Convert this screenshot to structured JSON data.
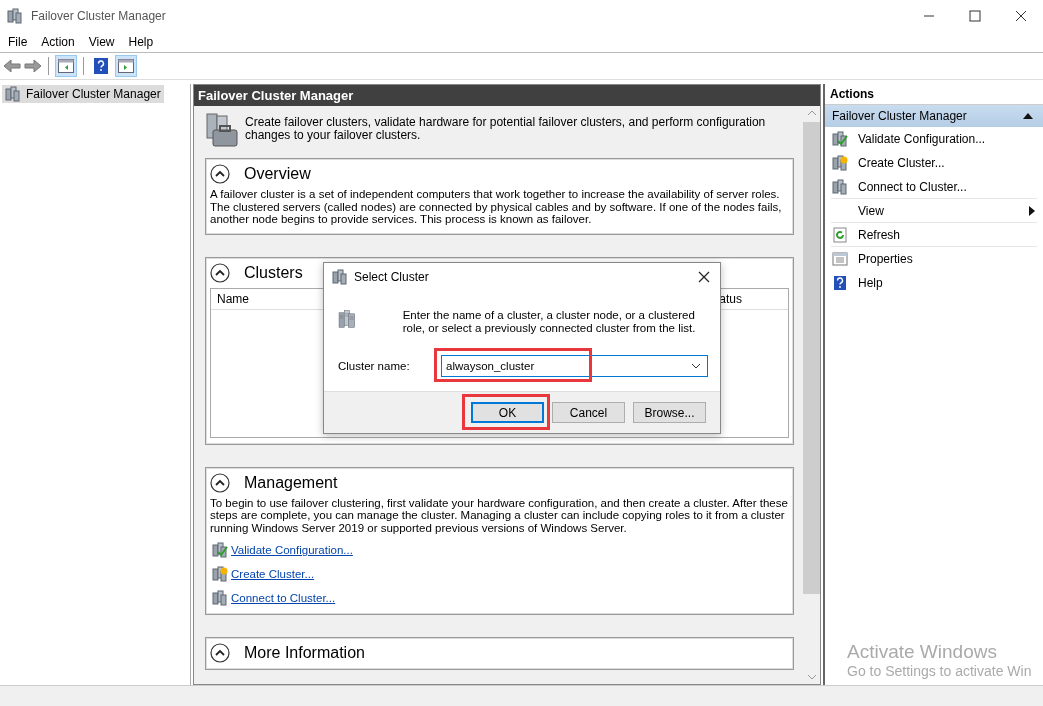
{
  "window": {
    "title": "Failover Cluster Manager"
  },
  "menu": [
    "File",
    "Action",
    "View",
    "Help"
  ],
  "toolbar": [
    {
      "kind": "back"
    },
    {
      "kind": "forward"
    },
    {
      "kind": "pane",
      "selected": true
    },
    {
      "kind": "help",
      "selected": false
    },
    {
      "kind": "pane2",
      "selected": true
    }
  ],
  "tree": {
    "items": [
      {
        "label": "Failover Cluster Manager",
        "selected": true
      }
    ]
  },
  "center": {
    "header": "Failover Cluster Manager",
    "intro": "Create failover clusters, validate hardware for potential failover clusters, and perform configuration changes to your failover clusters.",
    "sections": [
      {
        "kind": "text",
        "title": "Overview",
        "expanded": true,
        "body": "A failover cluster is a set of independent computers that work together to increase the availability of server roles. The clustered servers (called nodes) are connected by physical cables and by software. If one of the nodes fails, another node begins to provide services. This process is known as failover."
      },
      {
        "kind": "table",
        "title": "Clusters",
        "expanded": true,
        "columns": [
          "Name",
          "atus"
        ]
      },
      {
        "kind": "links",
        "title": "Management",
        "expanded": true,
        "body": "To begin to use failover clustering, first validate your hardware configuration, and then create a cluster.  After these steps are complete, you can manage the cluster. Managing a cluster can include copying roles to it from a cluster running Windows Server 2019 or supported previous versions of Windows Server.",
        "links": [
          {
            "label": "Validate Configuration...",
            "kind": "validate"
          },
          {
            "label": "Create Cluster...",
            "kind": "create"
          },
          {
            "label": "Connect to Cluster...",
            "kind": "connect"
          }
        ]
      },
      {
        "kind": "heading",
        "title": "More Information",
        "expanded": true
      }
    ]
  },
  "actions": {
    "title": "Actions",
    "group": "Failover Cluster Manager",
    "items": [
      {
        "label": "Validate Configuration...",
        "kind": "validate"
      },
      {
        "label": "Create Cluster...",
        "kind": "create"
      },
      {
        "label": "Connect to Cluster...",
        "kind": "connect"
      },
      {
        "label": "View",
        "kind": "submenu"
      },
      {
        "label": "Refresh",
        "kind": "refresh"
      },
      {
        "label": "Properties",
        "kind": "properties"
      },
      {
        "label": "Help",
        "kind": "help"
      }
    ]
  },
  "dialog": {
    "title": "Select Cluster",
    "message": "Enter the name of a cluster, a cluster node, or a clustered role, or select a previously connected cluster from the list.",
    "field_label": "Cluster name:",
    "field_value": "alwayson_cluster",
    "field_highlighted": true,
    "buttons": [
      {
        "label": "OK",
        "default": true,
        "highlighted": true
      },
      {
        "label": "Cancel",
        "default": false,
        "highlighted": false
      },
      {
        "label": "Browse...",
        "default": false,
        "highlighted": false
      }
    ]
  },
  "watermark": {
    "title": "Activate Windows",
    "subtitle": "Go to Settings to activate Win"
  }
}
